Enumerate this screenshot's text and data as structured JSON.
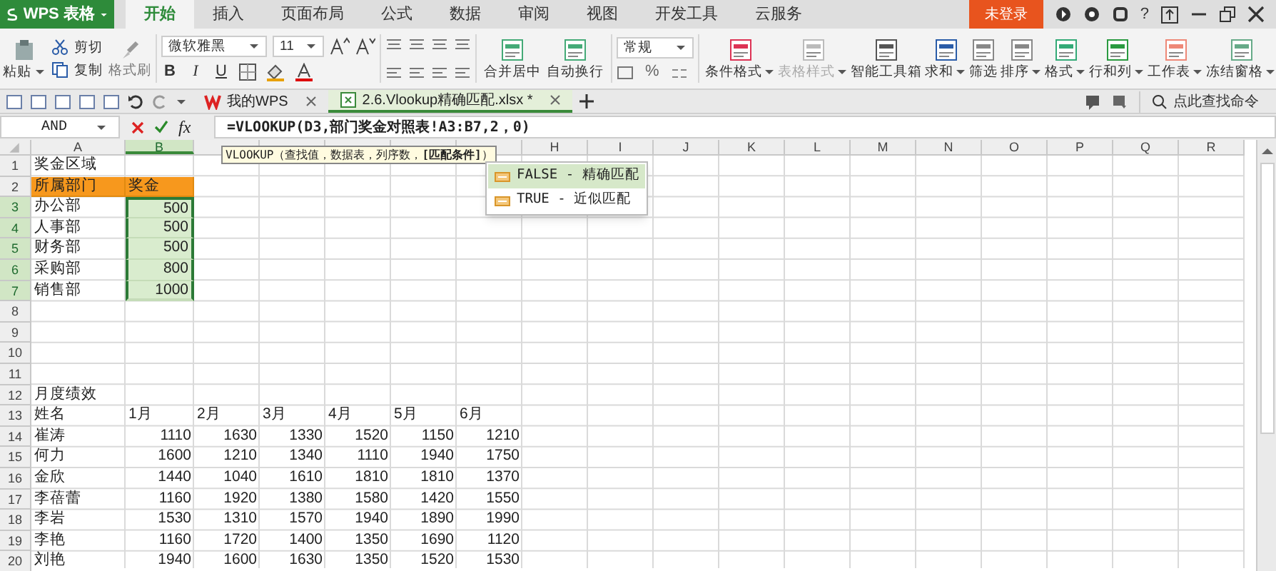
{
  "app": {
    "title": "WPS 表格"
  },
  "menu_tabs": [
    {
      "label": "开始",
      "selected": true
    },
    {
      "label": "插入",
      "selected": false
    },
    {
      "label": "页面布局",
      "selected": false
    },
    {
      "label": "公式",
      "selected": false
    },
    {
      "label": "数据",
      "selected": false
    },
    {
      "label": "审阅",
      "selected": false
    },
    {
      "label": "视图",
      "selected": false
    },
    {
      "label": "开发工具",
      "selected": false
    },
    {
      "label": "云服务",
      "selected": false
    }
  ],
  "login_button": "未登录",
  "help_button": "?",
  "ribbon": {
    "clipboard": {
      "paste": "粘贴",
      "cut": "剪切",
      "copy": "复制",
      "format_painter": "格式刷"
    },
    "font": {
      "name": "微软雅黑",
      "size": "11",
      "style_buttons": [
        "B",
        "I",
        "U"
      ]
    },
    "alignment": {
      "merge": "合并居中",
      "wrap": "自动换行"
    },
    "number": {
      "format": "常规",
      "percent": "%"
    },
    "tools": [
      {
        "label": "条件格式",
        "dropdown": true,
        "disabled": false
      },
      {
        "label": "表格样式",
        "dropdown": true,
        "disabled": true
      },
      {
        "label": "智能工具箱",
        "dropdown": false,
        "disabled": false
      },
      {
        "label": "求和",
        "dropdown": true,
        "disabled": false
      },
      {
        "label": "筛选",
        "dropdown": false,
        "disabled": false
      },
      {
        "label": "排序",
        "dropdown": true,
        "disabled": false
      },
      {
        "label": "格式",
        "dropdown": true,
        "disabled": false
      },
      {
        "label": "行和列",
        "dropdown": true,
        "disabled": false
      },
      {
        "label": "工作表",
        "dropdown": true,
        "disabled": false
      },
      {
        "label": "冻结窗格",
        "dropdown": true,
        "disabled": false
      }
    ]
  },
  "document_tabs": [
    {
      "label": "我的WPS",
      "selected": false
    },
    {
      "label": "2.6.Vlookup精确匹配.xlsx *",
      "selected": true
    }
  ],
  "command_search": {
    "placeholder": "点此查找命令"
  },
  "formula_bar": {
    "name_box": "AND",
    "formula": "=VLOOKUP(D3,部门奖金对照表!A3:B7,2，0)",
    "function_button": "fx"
  },
  "formula_tooltip": "VLOOKUP（查找值，数据表，列序数，**[匹配条件]**）",
  "autocomplete": [
    {
      "label": "FALSE - 精确匹配",
      "selected": true
    },
    {
      "label": "TRUE - 近似匹配",
      "selected": false
    }
  ],
  "sheet": {
    "columns": [
      {
        "label": "A",
        "selected": false
      },
      {
        "label": "B",
        "selected": true
      },
      {
        "selected": false
      },
      {
        "selected": false
      },
      {
        "selected": false
      },
      {
        "selected": false
      },
      {
        "selected": false
      },
      {
        "label": "H",
        "selected": false
      },
      {
        "label": "I",
        "selected": false
      },
      {
        "label": "J",
        "selected": false
      },
      {
        "label": "K",
        "selected": false
      },
      {
        "label": "L",
        "selected": false
      },
      {
        "label": "M",
        "selected": false
      },
      {
        "label": "N",
        "selected": false
      },
      {
        "label": "O",
        "selected": false
      },
      {
        "label": "P",
        "selected": false
      },
      {
        "label": "Q",
        "selected": false
      },
      {
        "label": "R",
        "selected": false
      }
    ],
    "rows": [
      {
        "number": "1",
        "selected": false,
        "cells": [
          {
            "text": "奖金区域",
            "kind": "text"
          }
        ]
      },
      {
        "number": "2",
        "selected": false,
        "cells": [
          {
            "text": "所属部门",
            "kind": "header"
          },
          {
            "text": "奖金",
            "kind": "header"
          }
        ]
      },
      {
        "number": "3",
        "selected": true,
        "cells": [
          {
            "text": "办公部",
            "kind": "text"
          },
          {
            "text": "500",
            "kind": "range"
          }
        ]
      },
      {
        "number": "4",
        "selected": true,
        "cells": [
          {
            "text": "人事部",
            "kind": "text"
          },
          {
            "text": "500",
            "kind": "range"
          }
        ]
      },
      {
        "number": "5",
        "selected": true,
        "cells": [
          {
            "text": "财务部",
            "kind": "text"
          },
          {
            "text": "500",
            "kind": "range"
          }
        ]
      },
      {
        "number": "6",
        "selected": true,
        "cells": [
          {
            "text": "采购部",
            "kind": "text"
          },
          {
            "text": "800",
            "kind": "range"
          }
        ]
      },
      {
        "number": "7",
        "selected": true,
        "cells": [
          {
            "text": "销售部",
            "kind": "text"
          },
          {
            "text": "1000",
            "kind": "range"
          }
        ]
      },
      {
        "number": "8",
        "selected": false
      },
      {
        "number": "9",
        "selected": false
      },
      {
        "number": "10",
        "selected": false
      },
      {
        "number": "11",
        "selected": false
      },
      {
        "number": "12",
        "selected": false,
        "cells": [
          {
            "text": "月度绩效",
            "kind": "text"
          }
        ]
      },
      {
        "number": "13",
        "selected": false,
        "cells": [
          {
            "text": "姓名",
            "kind": "text"
          },
          {
            "text": "1月",
            "kind": "text"
          },
          {
            "text": "2月",
            "kind": "text"
          },
          {
            "text": "3月",
            "kind": "text"
          },
          {
            "text": "4月",
            "kind": "text"
          },
          {
            "text": "5月",
            "kind": "text"
          },
          {
            "text": "6月",
            "kind": "text"
          }
        ]
      },
      {
        "number": "14",
        "selected": false,
        "cells": [
          {
            "text": "崔涛",
            "kind": "text"
          },
          {
            "text": "1110",
            "kind": "number"
          },
          {
            "text": "1630",
            "kind": "number"
          },
          {
            "text": "1330",
            "kind": "number"
          },
          {
            "text": "1520",
            "kind": "number"
          },
          {
            "text": "1150",
            "kind": "number"
          },
          {
            "text": "1210",
            "kind": "number"
          }
        ]
      },
      {
        "number": "15",
        "selected": false,
        "cells": [
          {
            "text": "何力",
            "kind": "text"
          },
          {
            "text": "1600",
            "kind": "number"
          },
          {
            "text": "1210",
            "kind": "number"
          },
          {
            "text": "1340",
            "kind": "number"
          },
          {
            "text": "1110",
            "kind": "number"
          },
          {
            "text": "1940",
            "kind": "number"
          },
          {
            "text": "1750",
            "kind": "number"
          }
        ]
      },
      {
        "number": "16",
        "selected": false,
        "cells": [
          {
            "text": "金欣",
            "kind": "text"
          },
          {
            "text": "1440",
            "kind": "number"
          },
          {
            "text": "1040",
            "kind": "number"
          },
          {
            "text": "1610",
            "kind": "number"
          },
          {
            "text": "1810",
            "kind": "number"
          },
          {
            "text": "1810",
            "kind": "number"
          },
          {
            "text": "1370",
            "kind": "number"
          }
        ]
      },
      {
        "number": "17",
        "selected": false,
        "cells": [
          {
            "text": "李蓓蕾",
            "kind": "text"
          },
          {
            "text": "1160",
            "kind": "number"
          },
          {
            "text": "1920",
            "kind": "number"
          },
          {
            "text": "1380",
            "kind": "number"
          },
          {
            "text": "1580",
            "kind": "number"
          },
          {
            "text": "1420",
            "kind": "number"
          },
          {
            "text": "1550",
            "kind": "number"
          }
        ]
      },
      {
        "number": "18",
        "selected": false,
        "cells": [
          {
            "text": "李岩",
            "kind": "text"
          },
          {
            "text": "1530",
            "kind": "number"
          },
          {
            "text": "1310",
            "kind": "number"
          },
          {
            "text": "1570",
            "kind": "number"
          },
          {
            "text": "1940",
            "kind": "number"
          },
          {
            "text": "1890",
            "kind": "number"
          },
          {
            "text": "1990",
            "kind": "number"
          }
        ]
      },
      {
        "number": "19",
        "selected": false,
        "cells": [
          {
            "text": "李艳",
            "kind": "text"
          },
          {
            "text": "1160",
            "kind": "number"
          },
          {
            "text": "1720",
            "kind": "number"
          },
          {
            "text": "1400",
            "kind": "number"
          },
          {
            "text": "1350",
            "kind": "number"
          },
          {
            "text": "1690",
            "kind": "number"
          },
          {
            "text": "1120",
            "kind": "number"
          }
        ]
      },
      {
        "number": "20",
        "selected": false,
        "cells": [
          {
            "text": "刘艳",
            "kind": "text"
          },
          {
            "text": "1940",
            "kind": "number"
          },
          {
            "text": "1600",
            "kind": "number"
          },
          {
            "text": "1630",
            "kind": "number"
          },
          {
            "text": "1350",
            "kind": "number"
          },
          {
            "text": "1520",
            "kind": "number"
          },
          {
            "text": "1530",
            "kind": "number"
          }
        ]
      }
    ]
  }
}
